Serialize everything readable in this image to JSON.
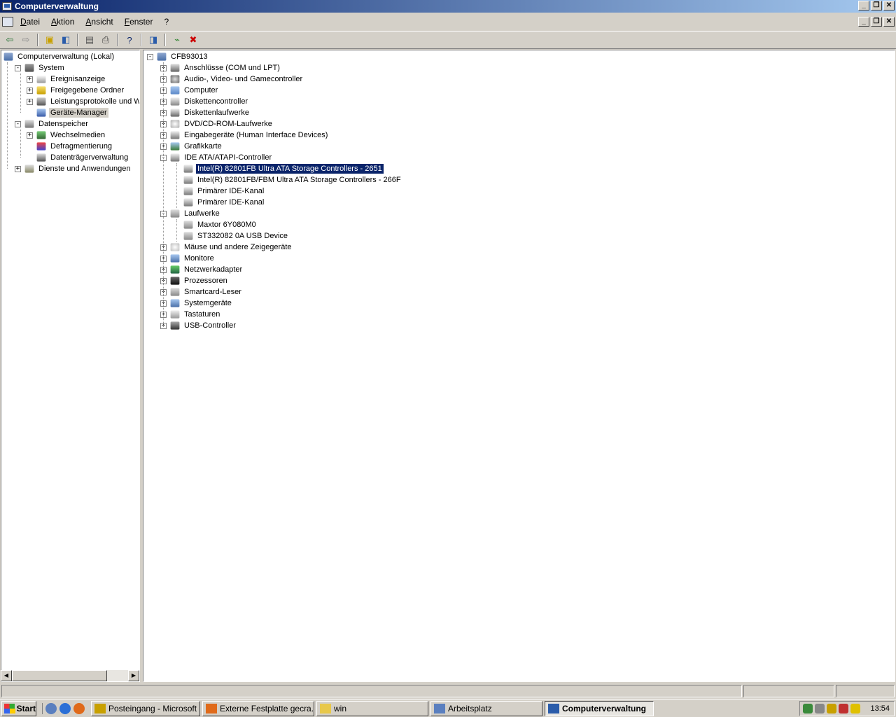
{
  "window": {
    "title": "Computerverwaltung",
    "min": "_",
    "restore": "❐",
    "close": "✕"
  },
  "menu": [
    "Datei",
    "Aktion",
    "Ansicht",
    "Fenster",
    "?"
  ],
  "toolbar": [
    {
      "name": "back-icon",
      "glyph": "⇦",
      "color": "#1f6f2f"
    },
    {
      "name": "forward-icon",
      "glyph": "⇨",
      "color": "#888"
    },
    {
      "name": "up-folder-icon",
      "glyph": "▣",
      "color": "#c8a000"
    },
    {
      "name": "show-tree-icon",
      "glyph": "◧",
      "color": "#2a5caa"
    },
    {
      "name": "properties-icon",
      "glyph": "▤",
      "color": "#555"
    },
    {
      "name": "print-icon",
      "glyph": "⎙",
      "color": "#333"
    },
    {
      "name": "help-icon",
      "glyph": "?",
      "color": "#0a246a"
    },
    {
      "name": "scan-hardware-icon",
      "glyph": "◨",
      "color": "#2a5caa"
    },
    {
      "name": "update-driver-icon",
      "glyph": "⌁",
      "color": "#3a8a3a"
    },
    {
      "name": "uninstall-icon",
      "glyph": "✖",
      "color": "#c00"
    }
  ],
  "left_tree": [
    {
      "label": "Computerverwaltung (Lokal)",
      "level": 0,
      "ex": "",
      "icon": "computer-icon"
    },
    {
      "label": "System",
      "level": 1,
      "ex": "-",
      "icon": "system-tools-icon"
    },
    {
      "label": "Ereignisanzeige",
      "level": 2,
      "ex": "+",
      "icon": "event-viewer-icon"
    },
    {
      "label": "Freigegebene Ordner",
      "level": 2,
      "ex": "+",
      "icon": "shared-folder-icon"
    },
    {
      "label": "Leistungsprotokolle und Warnungen",
      "level": 2,
      "ex": "+",
      "icon": "performance-logs-icon"
    },
    {
      "label": "Geräte-Manager",
      "level": 2,
      "ex": "",
      "icon": "device-manager-icon",
      "state": "gray"
    },
    {
      "label": "Datenspeicher",
      "level": 1,
      "ex": "-",
      "icon": "storage-icon"
    },
    {
      "label": "Wechselmedien",
      "level": 2,
      "ex": "+",
      "icon": "removable-media-icon"
    },
    {
      "label": "Defragmentierung",
      "level": 2,
      "ex": "",
      "icon": "defrag-icon"
    },
    {
      "label": "Datenträgerverwaltung",
      "level": 2,
      "ex": "",
      "icon": "disk-management-icon"
    },
    {
      "label": "Dienste und Anwendungen",
      "level": 1,
      "ex": "+",
      "icon": "services-icon"
    }
  ],
  "right_tree": [
    {
      "label": "CFB93013",
      "level": 0,
      "ex": "-",
      "icon": "computer-icon"
    },
    {
      "label": "Anschlüsse (COM und LPT)",
      "level": 1,
      "ex": "+",
      "icon": "port-icon"
    },
    {
      "label": "Audio-, Video- und Gamecontroller",
      "level": 1,
      "ex": "+",
      "icon": "audio-icon"
    },
    {
      "label": "Computer",
      "level": 1,
      "ex": "+",
      "icon": "computer-node-icon"
    },
    {
      "label": "Diskettencontroller",
      "level": 1,
      "ex": "+",
      "icon": "floppy-controller-icon"
    },
    {
      "label": "Diskettenlaufwerke",
      "level": 1,
      "ex": "+",
      "icon": "floppy-drive-icon"
    },
    {
      "label": "DVD/CD-ROM-Laufwerke",
      "level": 1,
      "ex": "+",
      "icon": "cdrom-icon"
    },
    {
      "label": "Eingabegeräte (Human Interface Devices)",
      "level": 1,
      "ex": "+",
      "icon": "hid-icon"
    },
    {
      "label": "Grafikkarte",
      "level": 1,
      "ex": "+",
      "icon": "display-adapter-icon"
    },
    {
      "label": "IDE ATA/ATAPI-Controller",
      "level": 1,
      "ex": "-",
      "icon": "ide-controller-icon"
    },
    {
      "label": "Intel(R) 82801FB Ultra ATA Storage Controllers - 2651",
      "level": 2,
      "ex": "",
      "icon": "ide-controller-icon",
      "state": "sel"
    },
    {
      "label": "Intel(R) 82801FB/FBM Ultra ATA Storage Controllers - 266F",
      "level": 2,
      "ex": "",
      "icon": "ide-controller-icon"
    },
    {
      "label": "Primärer IDE-Kanal",
      "level": 2,
      "ex": "",
      "icon": "ide-controller-icon"
    },
    {
      "label": "Primärer IDE-Kanal",
      "level": 2,
      "ex": "",
      "icon": "ide-controller-icon"
    },
    {
      "label": "Laufwerke",
      "level": 1,
      "ex": "-",
      "icon": "disk-drive-icon"
    },
    {
      "label": "Maxtor 6Y080M0",
      "level": 2,
      "ex": "",
      "icon": "disk-drive-icon"
    },
    {
      "label": "ST332082 0A USB Device",
      "level": 2,
      "ex": "",
      "icon": "disk-drive-icon"
    },
    {
      "label": "Mäuse und andere Zeigegeräte",
      "level": 1,
      "ex": "+",
      "icon": "mouse-icon"
    },
    {
      "label": "Monitore",
      "level": 1,
      "ex": "+",
      "icon": "monitor-icon"
    },
    {
      "label": "Netzwerkadapter",
      "level": 1,
      "ex": "+",
      "icon": "network-adapter-icon"
    },
    {
      "label": "Prozessoren",
      "level": 1,
      "ex": "+",
      "icon": "processor-icon"
    },
    {
      "label": "Smartcard-Leser",
      "level": 1,
      "ex": "+",
      "icon": "smartcard-icon"
    },
    {
      "label": "Systemgeräte",
      "level": 1,
      "ex": "+",
      "icon": "system-devices-icon"
    },
    {
      "label": "Tastaturen",
      "level": 1,
      "ex": "+",
      "icon": "keyboard-icon"
    },
    {
      "label": "USB-Controller",
      "level": 1,
      "ex": "+",
      "icon": "usb-icon"
    }
  ],
  "taskbar": {
    "start": "Start",
    "quicklaunch": [
      {
        "name": "show-desktop-icon",
        "color": "#5a7fbf"
      },
      {
        "name": "internet-explorer-icon",
        "color": "#2b6fd6"
      },
      {
        "name": "firefox-icon",
        "color": "#e06a1a"
      }
    ],
    "buttons": [
      {
        "label": "Posteingang - Microsoft ...",
        "icon": "outlook-icon",
        "color": "#c8a000"
      },
      {
        "label": "Externe Festplatte gecra...",
        "icon": "firefox-icon",
        "color": "#e06a1a"
      },
      {
        "label": "win",
        "icon": "folder-icon",
        "color": "#e8c84a"
      },
      {
        "label": "Arbeitsplatz",
        "icon": "my-computer-icon",
        "color": "#5a7fbf"
      },
      {
        "label": "Computerverwaltung",
        "icon": "computer-management-icon",
        "color": "#2a5caa",
        "active": true
      }
    ],
    "tray": [
      {
        "name": "network-tray-icon",
        "color": "#3a8a3a"
      },
      {
        "name": "pen-tray-icon",
        "color": "#888"
      },
      {
        "name": "power-tray-icon",
        "color": "#c8a000"
      },
      {
        "name": "security-tray-icon",
        "color": "#c03030"
      },
      {
        "name": "pencil-tray-icon",
        "color": "#e0c000"
      }
    ],
    "clock": "13:54"
  }
}
